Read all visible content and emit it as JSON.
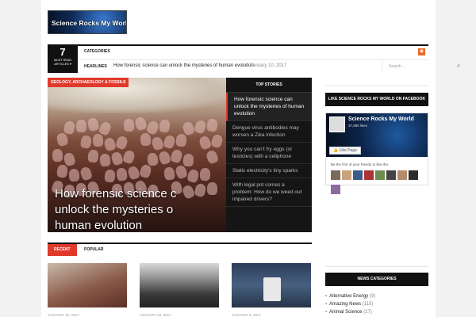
{
  "logo": {
    "text": "Science Rocks My World..."
  },
  "topbar": {
    "counter_num": "7",
    "counter_label": "MUST READ ARTICLES ▾",
    "categories_label": "CATEGORIES",
    "rss_icon": "rss-icon",
    "headlines_label": "HEADLINES",
    "headline_text": "How forensic science can unlock the mysteries of human evolution",
    "headline_date": "January 10, 2017",
    "search_placeholder": "Search ...",
    "search_icon": "magnifier-icon"
  },
  "featured": {
    "category": "GEOLOGY, ARCHAEOLOGY & FOSSILS",
    "title_lines": [
      "How forensic science c",
      "unlock the mysteries o",
      "human evolution"
    ]
  },
  "top_stories": {
    "heading": "TOP STORIES",
    "items": [
      "How forensic science can unlock the mysteries of human evolution",
      "Dengue virus antibodies may worsen a Zika infection",
      "Why you can't fry eggs (or testicles) with a cellphone",
      "Static electricity's tiny sparks",
      "With legal pot comes a problem: How do we weed out impaired drivers?"
    ]
  },
  "tabs": {
    "recent": "RECENT",
    "popular": "POPULAR"
  },
  "thumb_dates": [
    "JANUARY 10, 2017",
    "JANUARY 10, 2017",
    "JANUARY 9, 2017"
  ],
  "facebook": {
    "heading": "LIKE SCIENCE ROCKS MY WORLD ON FACEBOOK",
    "page_name": "Science Rocks My World",
    "likes": "37,880 likes",
    "like_button": "Like Page",
    "friends_text": "Be the first of your friends to like this",
    "face_colors": [
      "#7a6a5a",
      "#c9a27e",
      "#3b5b8a",
      "#a33",
      "#6b8e4e",
      "#444",
      "#b58a6a",
      "#2b2b2b",
      "#8a6d9e"
    ]
  },
  "news_categories": {
    "heading": "NEWS CATEGORIES",
    "items": [
      {
        "name": "Alternative Energy",
        "count": "(9)"
      },
      {
        "name": "Amazing News",
        "count": "(115)"
      },
      {
        "name": "Animal Science",
        "count": "(27)"
      }
    ]
  },
  "colors": {
    "accent": "#e03a2d",
    "dark": "#111111",
    "fb_blue": "#3b5998"
  }
}
